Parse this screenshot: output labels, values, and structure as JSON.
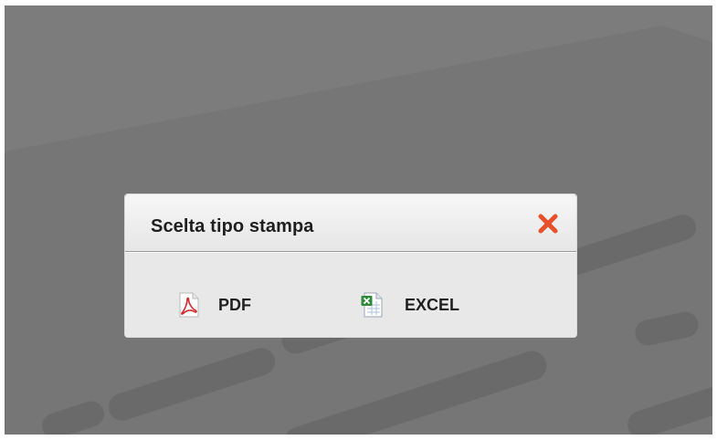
{
  "dialog": {
    "title": "Scelta tipo stampa",
    "close_icon": "close-icon",
    "options": [
      {
        "label": "PDF",
        "icon": "pdf-file-icon"
      },
      {
        "label": "EXCEL",
        "icon": "excel-file-icon"
      }
    ]
  },
  "colors": {
    "overlay": "#7a7a7a",
    "dialog_bg": "#ebebeb",
    "close_accent": "#e8502a"
  }
}
